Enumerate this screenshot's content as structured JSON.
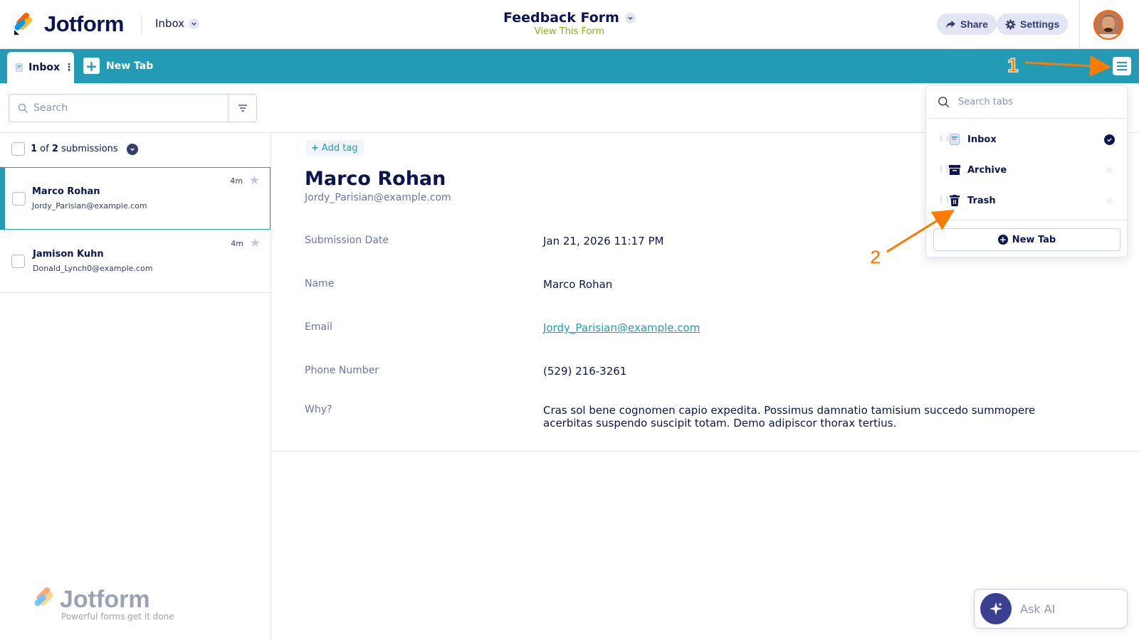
{
  "header": {
    "brand": "Jotform",
    "inbox_label": "Inbox",
    "form_title": "Feedback Form",
    "form_link": "View This Form",
    "share_label": "Share",
    "settings_label": "Settings"
  },
  "tabbar": {
    "active_tab": "Inbox",
    "new_tab_label": "New Tab"
  },
  "annotations": {
    "one": "1",
    "two": "2"
  },
  "list": {
    "search_placeholder": "Search",
    "count_current": "1",
    "count_of": " of ",
    "count_total": "2",
    "count_suffix": " submissions",
    "items": [
      {
        "name": "Marco Rohan",
        "email": "Jordy_Parisian@example.com",
        "time": "4m"
      },
      {
        "name": "Jamison Kuhn",
        "email": "Donald_Lynch0@example.com",
        "time": "4m"
      }
    ]
  },
  "detail": {
    "add_tag": "Add tag",
    "name": "Marco Rohan",
    "email": "Jordy_Parisian@example.com",
    "fields": [
      {
        "label": "Submission Date",
        "value": "Jan 21, 2026 11:17 PM"
      },
      {
        "label": "Name",
        "value": "Marco Rohan"
      },
      {
        "label": "Email",
        "value": "Jordy_Parisian@example.com"
      },
      {
        "label": "Phone Number",
        "value": "(529) 216-3261"
      },
      {
        "label": "Why?",
        "value": "Cras sol bene cognomen capio expedita. Possimus damnatio tamisium succedo summopere acerbitas suspendo suscipit totam. Demo adipiscor thorax tertius."
      }
    ]
  },
  "tabs_menu": {
    "search_placeholder": "Search tabs",
    "items": [
      {
        "label": "Inbox",
        "icon": "inbox-icon",
        "active": true
      },
      {
        "label": "Archive",
        "icon": "archive-icon",
        "active": false
      },
      {
        "label": "Trash",
        "icon": "trash-icon",
        "active": false
      }
    ],
    "new_tab_label": "New Tab"
  },
  "watermark": {
    "brand": "Jotform",
    "tagline": "Powerful forms get it done"
  },
  "ask_ai": {
    "label": "Ask AI"
  },
  "colors": {
    "accent": "#249bb4",
    "navy": "#0a1551",
    "annotation": "#ff7a00",
    "link_green": "#78bb07"
  }
}
